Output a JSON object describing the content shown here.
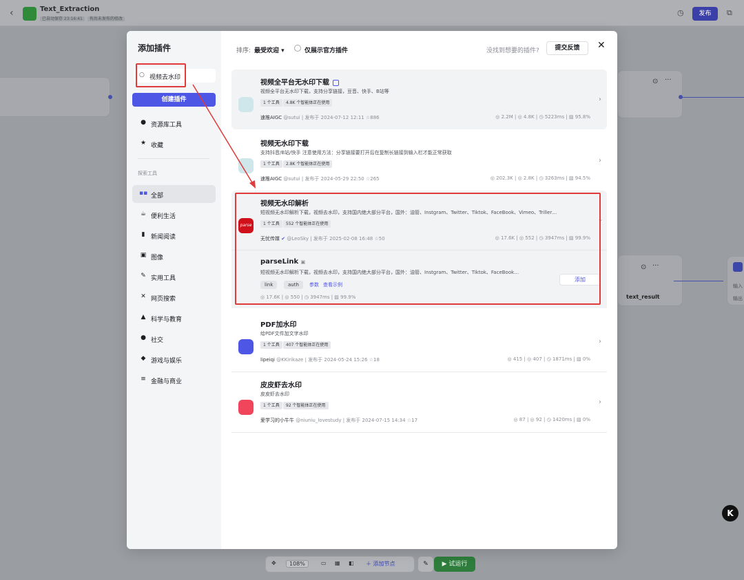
{
  "app": {
    "title": "Text_Extraction",
    "autosave": "已自动保存 23:16:41",
    "unpublished": "有尚未发布的修改",
    "publish_label": "发布"
  },
  "canvas": {
    "node_output": "text_result",
    "node_side_labels": [
      "输入",
      "输出"
    ],
    "zoom": "108%",
    "add_node": "添加节点",
    "run": "试运行"
  },
  "modal": {
    "title": "添加插件",
    "search_value": "视频去水印",
    "create_label": "创建插件",
    "top_nav": [
      {
        "label": "资源库工具",
        "icon": "person-icon"
      },
      {
        "label": "收藏",
        "icon": "star-icon"
      }
    ],
    "section_label": "探索工具",
    "categories": [
      {
        "label": "全部",
        "icon": "grid-icon",
        "active": true
      },
      {
        "label": "便利生活",
        "icon": "cup-icon"
      },
      {
        "label": "新闻阅读",
        "icon": "book-icon"
      },
      {
        "label": "图像",
        "icon": "image-icon"
      },
      {
        "label": "实用工具",
        "icon": "wrench-icon"
      },
      {
        "label": "网页搜索",
        "icon": "cross-icon"
      },
      {
        "label": "科学与教育",
        "icon": "graduation-cap-icon"
      },
      {
        "label": "社交",
        "icon": "chat-icon"
      },
      {
        "label": "游戏与娱乐",
        "icon": "gamepad-icon"
      },
      {
        "label": "金融与商业",
        "icon": "coins-icon"
      }
    ],
    "sort_label": "排序:",
    "sort_value": "最受欢迎",
    "official_only": "仅展示官方插件",
    "not_found": "没找到想要的插件?",
    "feedback": "提交反馈",
    "add_label": "添加"
  },
  "plugins": [
    {
      "title": "视频全平台无水印下载",
      "desc": "视频全平台无水印下载，支持分享链接，豆音、快手、B站等",
      "tags": [
        "1 个工具",
        "4.8K 个智能体正在使用"
      ],
      "author": "速推AIGC",
      "handle": "@sutui",
      "published": "发布于 2024-07-12 12:11",
      "favorites": "886",
      "stats": [
        "2.2M",
        "4.8K",
        "5223ms",
        "95.8%"
      ],
      "accent": "#cfe6ea"
    },
    {
      "title": "视频无水印下载",
      "desc": "支持抖音/B站/快手 注意使用方法：分享链接要打开后在复制长链接到输入栏才能正常获取",
      "tags": [
        "1 个工具",
        "2.8K 个智能体正在使用"
      ],
      "author": "速推AIGC",
      "handle": "@sutui",
      "published": "发布于 2024-05-29 22:50",
      "favorites": "265",
      "stats": [
        "202.3K",
        "2.8K",
        "3263ms",
        "94.5%"
      ],
      "accent": "#cfe6ea"
    },
    {
      "title": "视频无水印解析",
      "desc": "短视频无水印解析下载，视频去水印，支持国内绝大部分平台，国外：油管、Instgram、Twitter、Tiktok、FaceBook、Vimeo、Triller…",
      "tags": [
        "1 个工具",
        "552 个智能体正在使用"
      ],
      "author": "无忧传媒",
      "handle": "@LeoSky",
      "published": "发布于 2025-02-08 16:48",
      "favorites": "50",
      "stats": [
        "17.6K",
        "552",
        "3947ms",
        "99.9%"
      ],
      "accent": "#d0101a",
      "logo_text": "parse"
    },
    {
      "title": "PDF加水印",
      "desc": "给PDF文件加文字水印",
      "tags": [
        "1 个工具",
        "407 个智能体正在使用"
      ],
      "author": "lipeiqi",
      "handle": "@KKirikaze",
      "published": "发布于 2024-05-24 15:26",
      "favorites": "18",
      "stats": [
        "415",
        "407",
        "1871ms",
        "0%"
      ],
      "accent": "#4e56e6"
    },
    {
      "title": "皮皮虾去水印",
      "desc": "皮皮虾去水印",
      "tags": [
        "1 个工具",
        "92 个智能体正在使用"
      ],
      "author": "爱学习的小牛牛",
      "handle": "@niuniu_lovestudy",
      "published": "发布于 2024-07-15 14:34",
      "favorites": "17",
      "stats": [
        "87",
        "92",
        "1420ms",
        "0%"
      ],
      "accent": "#f0455a"
    }
  ],
  "tool": {
    "name": "parseLink",
    "desc": "短视频无水印解析下载，视频去水印，支持国内绝大部分平台，国外：油管、Instgram、Twitter、Tiktok、FaceBook…",
    "params": [
      "link",
      "auth"
    ],
    "params_label": "参数",
    "example_label": "查看示例",
    "stats": [
      "17.6K",
      "550",
      "3947ms",
      "99.9%"
    ]
  },
  "colors": {
    "accent": "#4e56e6",
    "annotation_red": "#e03a3a"
  }
}
